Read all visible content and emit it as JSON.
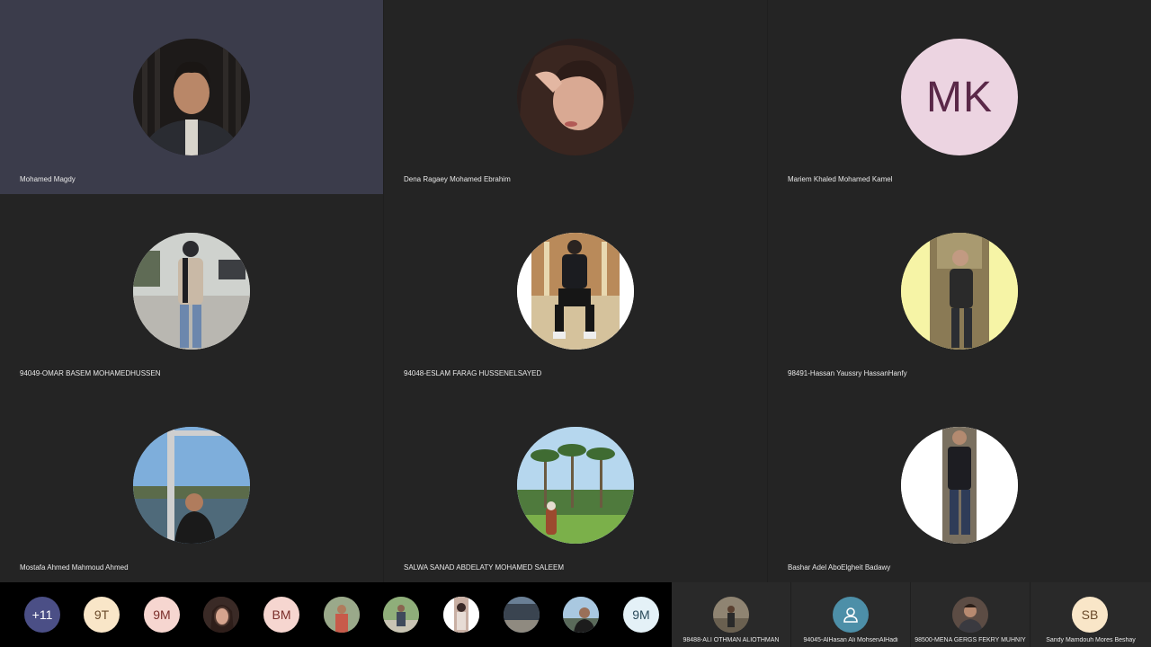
{
  "participants": [
    {
      "name": "Mohamed Magdy"
    },
    {
      "name": "Dena Ragaey Mohamed Ebrahim"
    },
    {
      "name": "Mariem Khaled Mohamed Kamel",
      "initials": "MK"
    },
    {
      "name": "94049-OMAR BASEM MOHAMEDHUSSEN"
    },
    {
      "name": "94048-ESLAM FARAG HUSSENELSAYED"
    },
    {
      "name": "98491-Hassan Yaussry HassanHanfy"
    },
    {
      "name": "Mostafa Ahmed Mahmoud Ahmed"
    },
    {
      "name": "SALWA SANAD ABDELATY MOHAMED SALEEM"
    },
    {
      "name": "Bashar Adel AboElgheit Badawy"
    }
  ],
  "overflow": {
    "more_count": "+11",
    "chips": [
      "9T",
      "9M",
      "BM",
      "9M"
    ]
  },
  "mini_tiles": [
    {
      "name": "98488-ALI OTHMAN ALIOTHMAN"
    },
    {
      "name": "94045-AlHasan  Ali MohsenAlHadi"
    },
    {
      "name": "98500-MENA GERGS FEKRY MUHNIY"
    },
    {
      "name": "Sandy Mamdouh Mores Beshay",
      "initials": "SB"
    }
  ]
}
